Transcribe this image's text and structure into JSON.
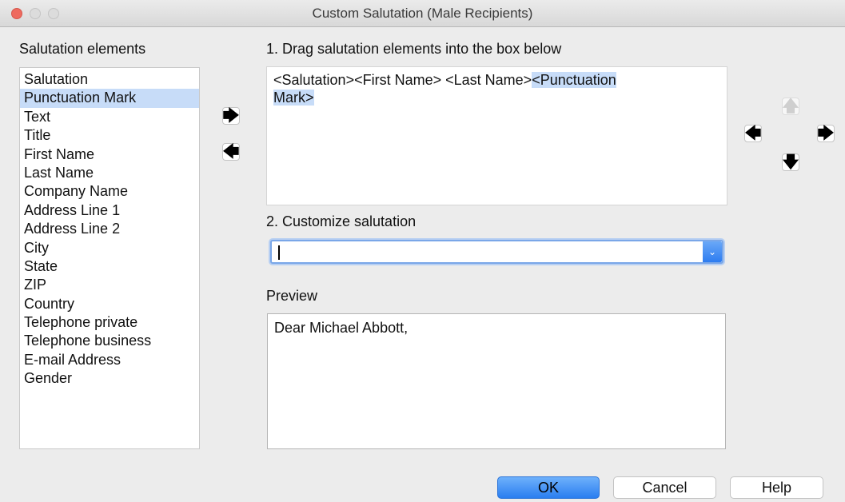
{
  "window": {
    "title": "Custom Salutation (Male Recipients)"
  },
  "elements": {
    "heading": "Salutation elements",
    "items": [
      "Salutation",
      "Punctuation Mark",
      "Text",
      "Title",
      "First Name",
      "Last Name",
      "Company Name",
      "Address Line 1",
      "Address Line 2",
      "City",
      "State",
      "ZIP",
      "Country",
      "Telephone private",
      "Telephone business",
      "E-mail Address",
      "Gender"
    ],
    "selected": "Punctuation Mark"
  },
  "drag": {
    "heading": "1. Drag salutation elements into the box below",
    "text_plain": "<Salutation><First Name> <Last Name>",
    "text_highlight_1": "<Punctuation",
    "text_highlight_2": "Mark>"
  },
  "customize": {
    "heading": "2. Customize salutation",
    "value": ""
  },
  "preview": {
    "heading": "Preview",
    "text": "Dear Michael Abbott,"
  },
  "arrows": {
    "add": "🡆",
    "remove": "🡄",
    "up": "🡅",
    "down": "🡇",
    "left": "🡄",
    "right": "🡆"
  },
  "icons": {
    "add": "right-arrow-icon",
    "remove": "left-arrow-icon",
    "up": "up-arrow-icon",
    "down": "down-arrow-icon"
  },
  "buttons": {
    "ok": "OK",
    "cancel": "Cancel",
    "help": "Help"
  },
  "colors": {
    "selection": "#c7dcf8",
    "accent": "#2a7ef0",
    "close": "#ee6a5f"
  }
}
